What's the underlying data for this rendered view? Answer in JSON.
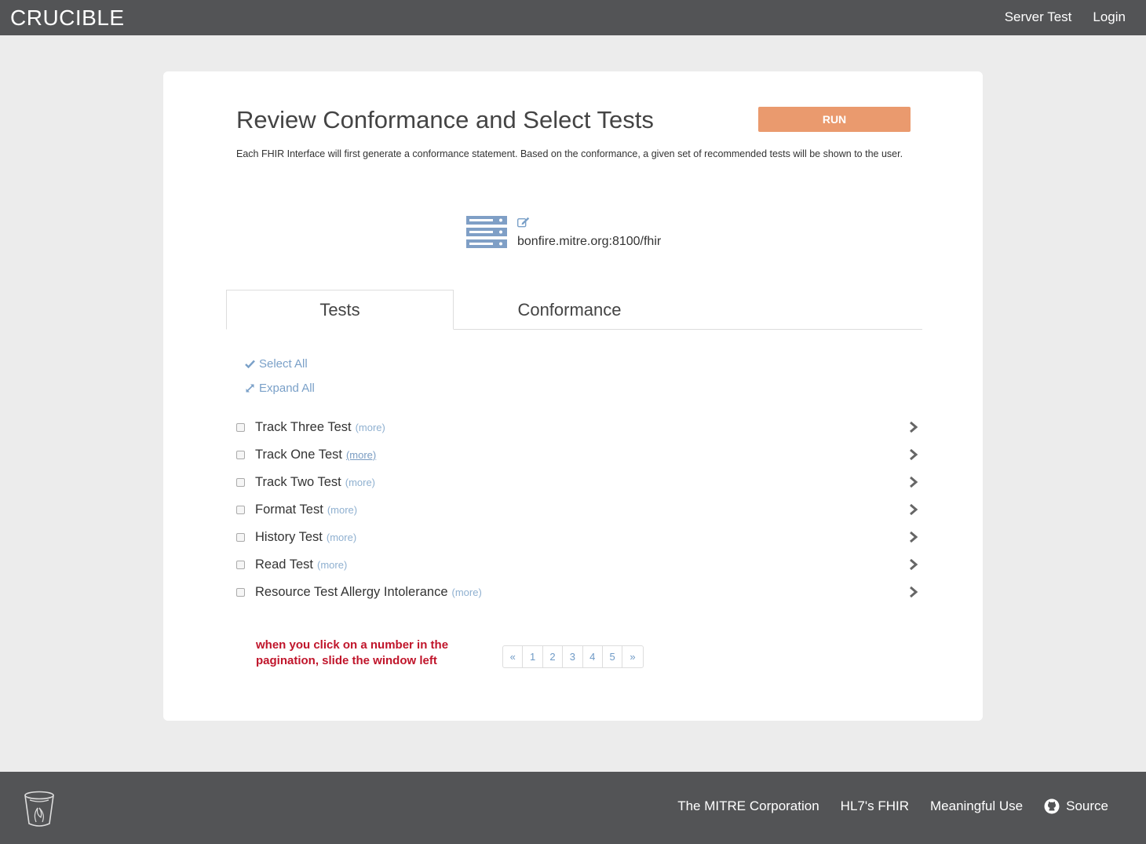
{
  "header": {
    "brand": "CRUCIBLE",
    "nav": [
      {
        "label": "Server Test"
      },
      {
        "label": "Login"
      }
    ]
  },
  "main": {
    "title": "Review Conformance and Select Tests",
    "run_label": "RUN",
    "description": "Each FHIR Interface will first generate a conformance statement. Based on the conformance, a given set of recommended tests will be shown to the user.",
    "server_url": "bonfire.mitre.org:8100/fhir",
    "tabs": [
      {
        "label": "Tests",
        "active": true
      },
      {
        "label": "Conformance",
        "active": false
      }
    ],
    "select_all": "Select All",
    "expand_all": "Expand All",
    "tests": [
      {
        "name": "Track Three Test",
        "more": "(more)",
        "checked": false
      },
      {
        "name": "Track One Test",
        "more": "(more)",
        "checked": false
      },
      {
        "name": "Track Two Test",
        "more": "(more)",
        "checked": false
      },
      {
        "name": "Format Test",
        "more": "(more)",
        "checked": false
      },
      {
        "name": "History Test",
        "more": "(more)",
        "checked": false
      },
      {
        "name": "Read Test",
        "more": "(more)",
        "checked": false
      },
      {
        "name": "Resource Test Allergy Intolerance",
        "more": "(more)",
        "checked": false
      }
    ],
    "annotation": "when you click on a number in the pagination, slide the window left",
    "pagination": {
      "prev": "«",
      "pages": [
        "1",
        "2",
        "3",
        "4",
        "5"
      ],
      "next": "»"
    }
  },
  "footer": {
    "links": [
      {
        "label": "The MITRE Corporation"
      },
      {
        "label": "HL7's FHIR"
      },
      {
        "label": "Meaningful Use"
      },
      {
        "label": "Source",
        "icon": "github-icon"
      }
    ]
  },
  "colors": {
    "header_bg": "#535456",
    "run_button": "#ea9a6e",
    "link_blue": "#7aa0c8",
    "annotation_red": "#c0152b",
    "page_bg": "#ececec"
  }
}
